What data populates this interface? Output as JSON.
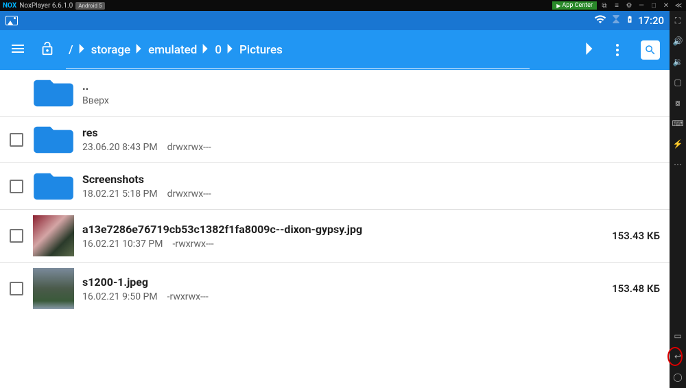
{
  "titlebar": {
    "logo": "NOX",
    "app_name": "NoxPlayer 6.6.1.0",
    "android_badge": "Android 5",
    "app_center": "App Center"
  },
  "status_bar": {
    "time": "17:20"
  },
  "breadcrumb": {
    "root": "/",
    "parts": [
      "storage",
      "emulated",
      "0",
      "Pictures"
    ]
  },
  "files": [
    {
      "name": "..",
      "sub": "Вверх",
      "type": "up"
    },
    {
      "name": "res",
      "date": "23.06.20 8:43 PM",
      "perm": "drwxrwx---",
      "type": "folder"
    },
    {
      "name": "Screenshots",
      "date": "18.02.21 5:18 PM",
      "perm": "drwxrwx---",
      "type": "folder"
    },
    {
      "name": "a13e7286e76719cb53c1382f1fa8009c--dixon-gypsy.jpg",
      "date": "16.02.21 10:37 PM",
      "perm": "-rwxrwx---",
      "size": "153.43 КБ",
      "type": "image",
      "thumb": "img1"
    },
    {
      "name": "s1200-1.jpeg",
      "date": "16.02.21 9:50 PM",
      "perm": "-rwxrwx---",
      "size": "153.48 КБ",
      "type": "image",
      "thumb": "img2"
    }
  ]
}
